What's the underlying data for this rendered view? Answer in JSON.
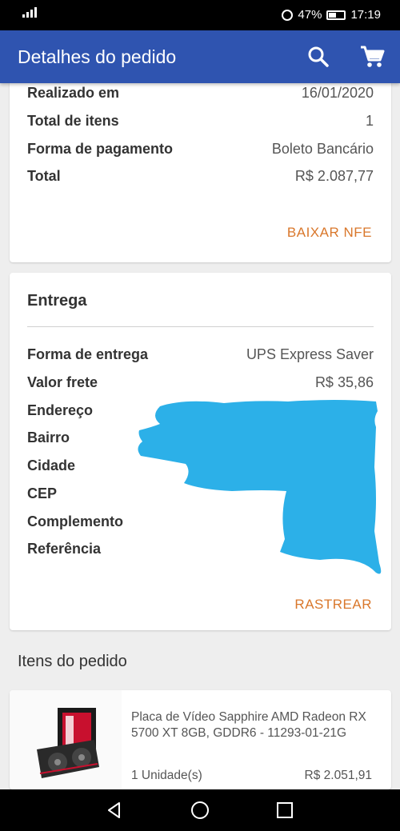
{
  "status_bar": {
    "battery": "47%",
    "time": "17:19"
  },
  "header": {
    "title": "Detalhes do pedido"
  },
  "summary": {
    "rows": [
      {
        "label": "Realizado em",
        "value": "16/01/2020"
      },
      {
        "label": "Total de itens",
        "value": "1"
      },
      {
        "label": "Forma de pagamento",
        "value": "Boleto Bancário"
      },
      {
        "label": "Total",
        "value": "R$ 2.087,77"
      }
    ],
    "action": "BAIXAR NFE"
  },
  "delivery": {
    "title": "Entrega",
    "rows": [
      {
        "label": "Forma de entrega",
        "value": "UPS Express Saver"
      },
      {
        "label": "Valor frete",
        "value": "R$ 35,86"
      },
      {
        "label": "Endereço",
        "value": ""
      },
      {
        "label": "Bairro",
        "value": ""
      },
      {
        "label": "Cidade",
        "value": ""
      },
      {
        "label": "CEP",
        "value": ""
      },
      {
        "label": "Complemento",
        "value": ""
      },
      {
        "label": "Referência",
        "value": ""
      }
    ],
    "action": "RASTREAR",
    "redaction_color": "#2cb0e8"
  },
  "items": {
    "title": "Itens do pedido",
    "list": [
      {
        "name": "Placa de Vídeo Sapphire AMD Radeon RX 5700 XT 8GB, GDDR6 - 11293-01-21G",
        "quantity": "1 Unidade(s)",
        "price": "R$ 2.051,91"
      }
    ]
  },
  "colors": {
    "app_bar": "#2f54b0",
    "accent": "#d9772b"
  }
}
